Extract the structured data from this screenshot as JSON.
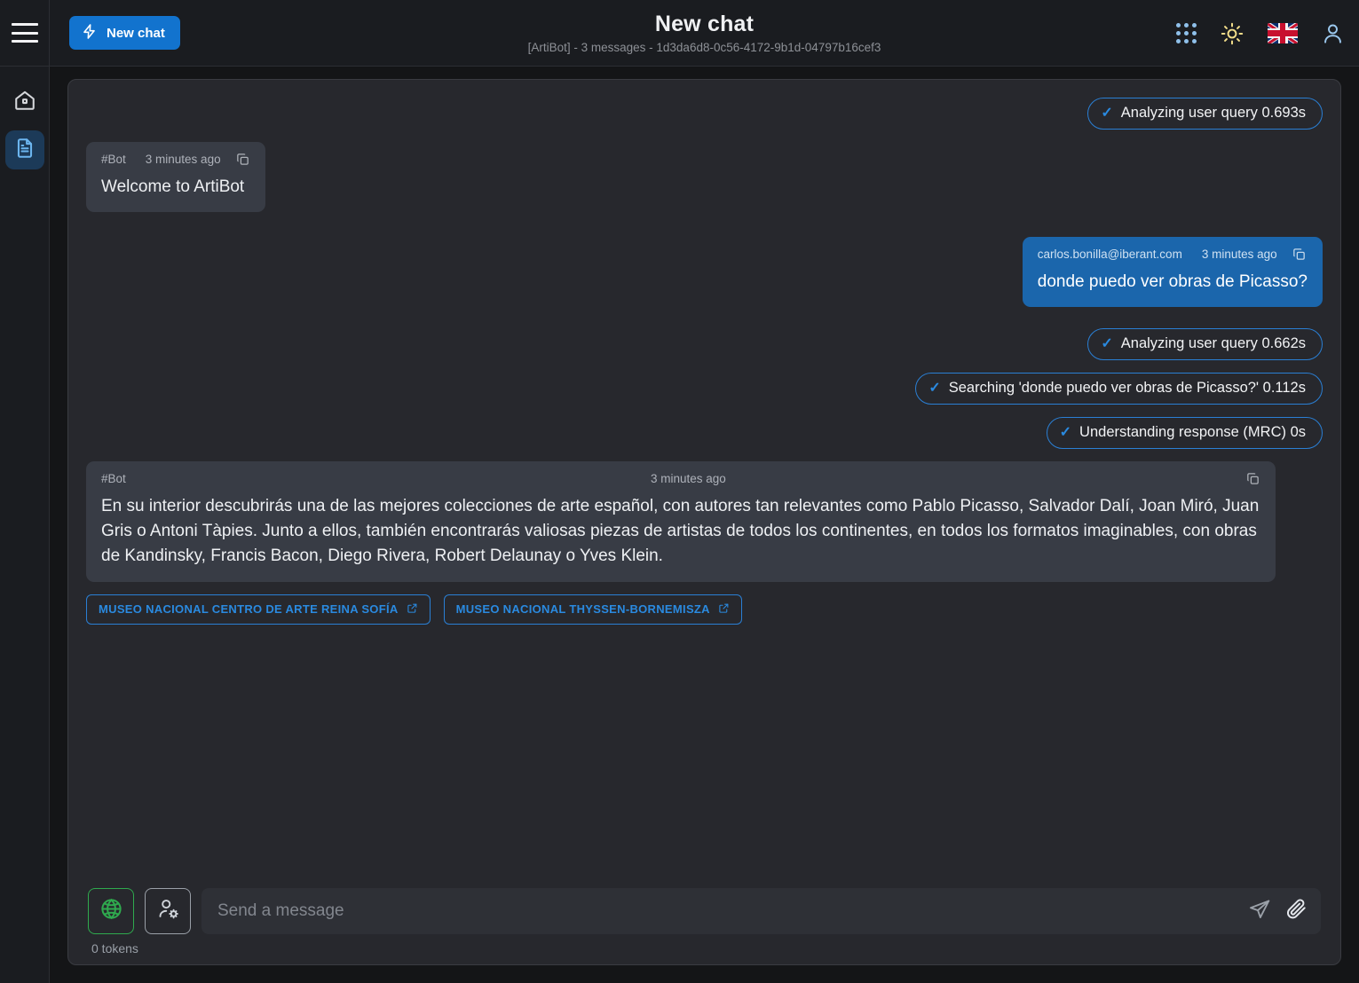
{
  "theme": {
    "accent_blue": "#1273ce",
    "pill_blue": "#2a7fd4",
    "user_bubble_blue": "#1b66ac",
    "bot_bubble_gray": "#383c45",
    "panel_bg": "#27282d",
    "rail_bg": "#1a1c20",
    "green": "#2faa4e"
  },
  "rail": {
    "menu_icon": "hamburger-icon",
    "items": [
      {
        "icon": "home-icon",
        "name": "home",
        "active": false
      },
      {
        "icon": "document-icon",
        "name": "documents",
        "active": true
      }
    ]
  },
  "header": {
    "new_chat_label": "New chat",
    "new_chat_icon": "lightning-bolt-icon",
    "title": "New chat",
    "subtitle": "[ArtiBot] - 3 messages - 1d3da6d8-0c56-4172-9b1d-04797b16cef3",
    "icons": [
      {
        "name": "apps-grid-icon",
        "label": "Apps"
      },
      {
        "name": "sun-icon",
        "label": "Light theme"
      },
      {
        "name": "flag-uk-icon",
        "label": "English"
      },
      {
        "name": "account-icon",
        "label": "Account"
      }
    ]
  },
  "conversation": [
    {
      "kind": "status",
      "icon": "check-icon",
      "text": "Analyzing user query 0.693s",
      "align": "right"
    },
    {
      "kind": "message",
      "align": "left",
      "author": "#Bot",
      "time": "3 minutes ago",
      "copy_icon": "copy-icon",
      "text": "Welcome to ArtiBot"
    },
    {
      "kind": "message",
      "align": "right",
      "author": "carlos.bonilla@iberant.com",
      "time": "3 minutes ago",
      "copy_icon": "copy-icon",
      "text": "donde puedo ver obras de Picasso?"
    },
    {
      "kind": "status",
      "icon": "check-icon",
      "text": "Analyzing user query 0.662s",
      "align": "right"
    },
    {
      "kind": "status",
      "icon": "check-icon",
      "text": "Searching 'donde puedo ver obras de Picasso?' 0.112s",
      "align": "right"
    },
    {
      "kind": "status",
      "icon": "check-icon",
      "text": "Understanding response (MRC) 0s",
      "align": "right"
    },
    {
      "kind": "message-wide",
      "align": "left",
      "author": "#Bot",
      "time": "3 minutes ago",
      "copy_icon": "copy-icon",
      "text": "En su interior descubrirás una de las mejores colecciones de arte español, con autores tan relevantes como Pablo Picasso, Salvador Dalí, Joan Miró, Juan Gris o Antoni Tàpies. Junto a ellos, también encontrarás valiosas piezas de artistas de todos los continentes, en todos los formatos imaginables, con obras de Kandinsky, Francis Bacon, Diego Rivera, Robert Delaunay o Yves Klein."
    }
  ],
  "sources": [
    {
      "label": "MUSEO NACIONAL CENTRO DE ARTE REINA SOFÍA",
      "icon": "external-link-icon"
    },
    {
      "label": "MUSEO NACIONAL THYSSEN-BORNEMISZA",
      "icon": "external-link-icon"
    }
  ],
  "composer": {
    "globe_icon": "globe-icon",
    "user_settings_icon": "user-settings-icon",
    "placeholder": "Send a message",
    "value": "",
    "send_icon": "send-icon",
    "attach_icon": "paperclip-icon",
    "tokens": "0 tokens"
  }
}
